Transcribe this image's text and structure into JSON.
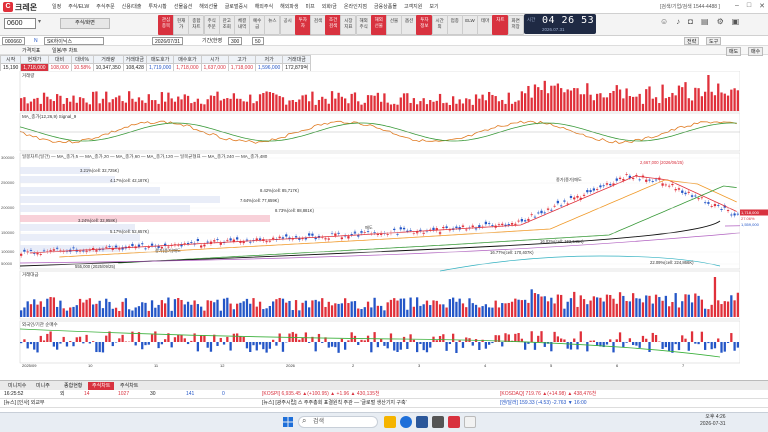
{
  "app": {
    "logo_mark": "C",
    "name": "크레온",
    "menus": [
      "일정",
      "주식/ELW",
      "주식주문",
      "신용/대출",
      "투자시황",
      "선물옵션",
      "해외선물",
      "글로벌증시",
      "해외주식",
      "해외파생",
      "미프",
      "외화/금",
      "온라인지점",
      "금융상품몰",
      "고객지원",
      "보기"
    ],
    "header_right": "[검색/기업/검색 1544-4488 ]"
  },
  "toolbar": {
    "code": "0600",
    "stock_button": "주식/화면",
    "buttons": [
      {
        "label": "관심\n종목",
        "color": "red"
      },
      {
        "label": "현재\n가",
        "color": "gray"
      },
      {
        "label": "종합\n차트",
        "color": "gray"
      },
      {
        "label": "주식\n주문",
        "color": "gray"
      },
      {
        "label": "잔고\n조회",
        "color": "gray"
      },
      {
        "label": "체결\n내역",
        "color": "gray"
      },
      {
        "label": "예수\n금",
        "color": "gray"
      },
      {
        "label": "뉴스",
        "color": "gray"
      },
      {
        "label": "공시",
        "color": "gray"
      },
      {
        "label": "투자\n자",
        "color": "red"
      },
      {
        "label": "검색",
        "color": "gray"
      },
      {
        "label": "조건\n검색",
        "color": "red"
      },
      {
        "label": "시장\n지표",
        "color": "gray"
      },
      {
        "label": "해외\n주식",
        "color": "gray"
      },
      {
        "label": "해외\n선물",
        "color": "red"
      },
      {
        "label": "선물",
        "color": "gray"
      },
      {
        "label": "옵션",
        "color": "gray"
      },
      {
        "label": "투자\n정보",
        "color": "red"
      },
      {
        "label": "시간\n외",
        "color": "gray"
      },
      {
        "label": "업종",
        "color": "gray"
      },
      {
        "label": "ELW",
        "color": "gray"
      },
      {
        "label": "테마",
        "color": "gray"
      },
      {
        "label": "차트",
        "color": "red"
      },
      {
        "label": "화면\n저장",
        "color": "gray"
      }
    ],
    "clock": {
      "label": "시간",
      "time": "04 26 53",
      "date": "2026.07.31"
    }
  },
  "stock_row": {
    "code": "000660",
    "market": "N",
    "name": "SK하이닉스",
    "date": "2026/07/31",
    "period": "기간(한영",
    "count": "300",
    "unit": "50",
    "right_buttons": [
      "전략",
      "도구",
      "매도",
      "매수"
    ]
  },
  "chart_tabs": [
    "가격지표",
    "일봉/주 차트"
  ],
  "quote": {
    "headers": [
      "시작",
      "현재가",
      "대비",
      "대비%",
      "거래량",
      "거래대금",
      "매도호가",
      "매수호가",
      "시가",
      "고가",
      "저가",
      "거래대금"
    ],
    "values": [
      "15,190",
      "1,718,000",
      "108,000",
      "10.58%",
      "10,347,350",
      "108,428",
      "1,719,000",
      "1,718,000",
      "1,637,000",
      "1,718,000",
      "1,596,000",
      "172,879억"
    ]
  },
  "chart_labels": {
    "volume_top": "거래량",
    "indicator1": "MACD_Oscillator",
    "indicator2": "MA_종가(12,26,9) Signal_9",
    "price_title": "일봉차트(일간) — MA_종가,5 — MA_종가,20 — MA_종가,60 — MA_종가,120 — 일목균형표 — MA_종가,240 — MA_종가,480",
    "volume_panel": "거래대금",
    "flow_panel": "외국인/기관 순매수",
    "annotations": [
      "3.21%(cell: 32,725K)",
      "4.17%(cell: 42,187K)",
      "8.42%(cell: 85,717K)",
      "7.64%(cell: 77,659K)",
      "8.73%(cell: 88,881K)",
      "3.24%(cell: 32,958K)",
      "5.17%(cell: 52,657K)",
      "16.02%(cell: 162,645K)",
      "16.77%(cell: 170,407K)",
      "22.09%(cell: 224,866K)",
      "매도",
      "종가(종가)매도",
      "종가(종가)매도",
      "2,667,000 (2026/06/25)",
      "555,000 (2025/09/25)"
    ],
    "price_ticks": [
      "300000",
      "250000",
      "200000",
      "150000",
      "100000",
      "50000"
    ],
    "right_scale": [
      "1,718,000",
      "27.06%",
      "1,559,000"
    ],
    "x_ticks": [
      "2025/09",
      "10",
      "11",
      "12",
      "2026",
      "2",
      "3",
      "4",
      "5",
      "6",
      "7"
    ]
  },
  "bottom_tabs": [
    "미니지수",
    "미니주",
    "종합현황",
    "주식차트",
    "주식차트"
  ],
  "ticker1": [
    {
      "text": "16:25:52",
      "color": "#222"
    },
    {
      "text": "외",
      "color": "#222"
    },
    {
      "text": "14",
      "color": "#d8323f"
    },
    {
      "text": "1027",
      "color": "#d8323f"
    },
    {
      "text": "30",
      "color": "#222"
    },
    {
      "text": "141",
      "color": "#2456c7"
    },
    {
      "text": "0",
      "color": "#2456c7"
    },
    {
      "text": "[KOSPI] 6,935.45 ▲(+100.95) ▲ +1.96 ▲ 430,135천",
      "color": "#d8323f"
    },
    {
      "text": "[KOSDAQ] 719.76 ▲(+14.98) ▲ 438,476천",
      "color": "#d8323f"
    }
  ],
  "ticker2": [
    {
      "text": "[뉴스] [인사] 외교부",
      "color": "#222"
    },
    {
      "text": "[뉴스] [광주시립] 스 주주총회 표결원칙 주관 — '글로벌 생산기지 구축'",
      "color": "#222"
    },
    {
      "text": "[엔/달러] 159.33 (-4.53) -2.763 ▼ 16:00",
      "color": "#2456c7"
    }
  ],
  "taskbar": {
    "search": "검색",
    "tray_time": "오후 4:26",
    "tray_date": "2026-07-31"
  },
  "colors": {
    "brand_red": "#d8323f",
    "up": "#e0303a",
    "down": "#2456c7",
    "clock_bg": "#1f2a44"
  }
}
